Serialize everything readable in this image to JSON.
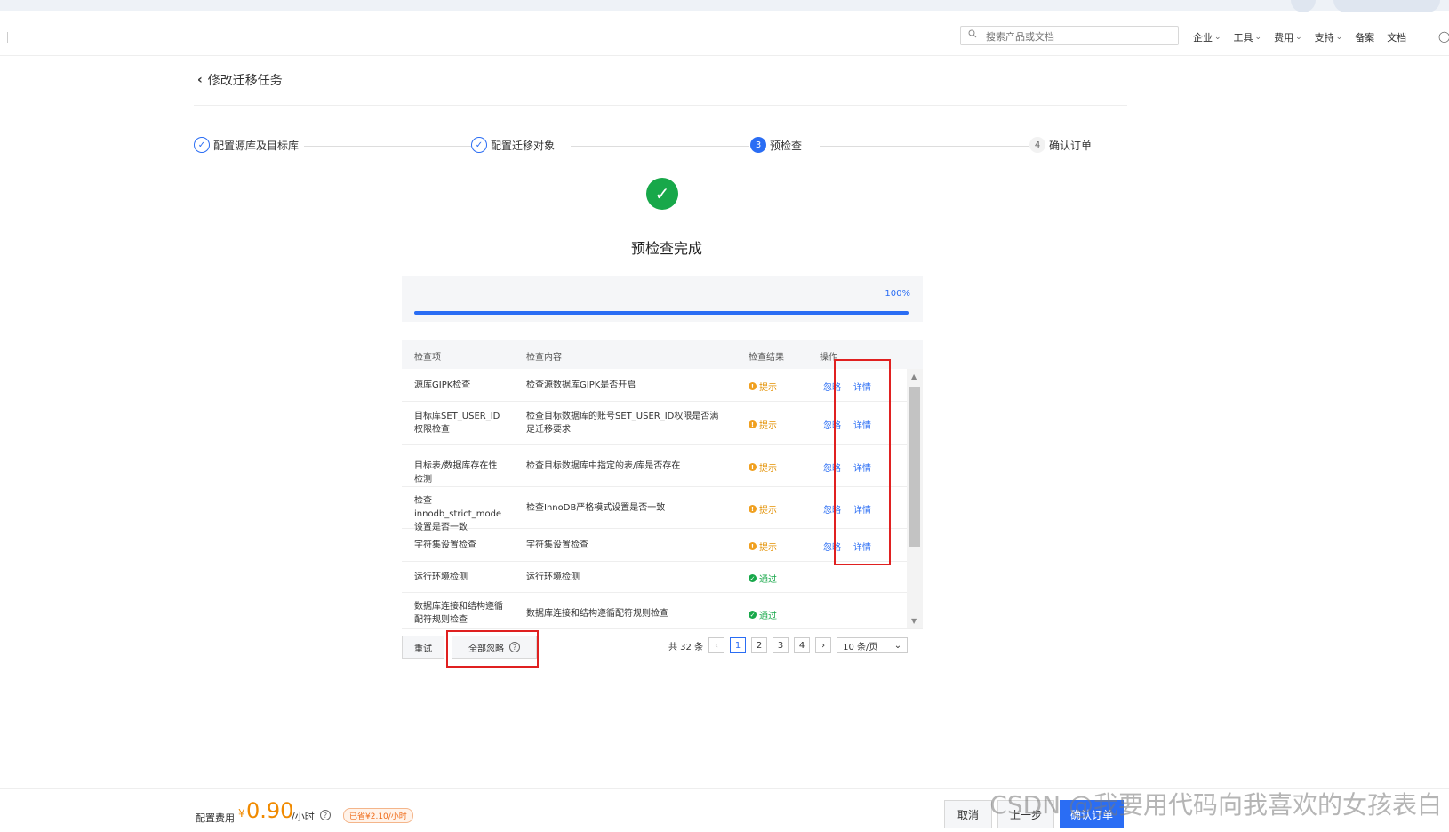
{
  "topbar": {
    "search_placeholder": "搜索产品或文档",
    "nav": [
      {
        "label": "企业",
        "dropdown": true
      },
      {
        "label": "工具",
        "dropdown": true
      },
      {
        "label": "费用",
        "dropdown": true
      },
      {
        "label": "支持",
        "dropdown": true
      },
      {
        "label": "备案",
        "dropdown": false
      },
      {
        "label": "文档",
        "dropdown": false
      }
    ]
  },
  "header": {
    "title": "修改迁移任务"
  },
  "steps": [
    {
      "num": "✓",
      "label": "配置源库及目标库",
      "state": "done"
    },
    {
      "num": "✓",
      "label": "配置迁移对象",
      "state": "done"
    },
    {
      "num": "3",
      "label": "预检查",
      "state": "active"
    },
    {
      "num": "4",
      "label": "确认订单",
      "state": "pending"
    }
  ],
  "status": {
    "title": "预检查完成"
  },
  "progress": {
    "percent_label": "100%",
    "value": 1.0
  },
  "table": {
    "columns": [
      "检查项",
      "检查内容",
      "检查结果",
      "操作"
    ],
    "rows": [
      {
        "item": "源库GIPK检查",
        "content": "检查源数据库GIPK是否开启",
        "result": "提示",
        "level": "warn",
        "actions": [
          "忽略",
          "详情"
        ]
      },
      {
        "item": "目标库SET_USER_ID权限检查",
        "content": "检查目标数据库的账号SET_USER_ID权限是否满足迁移要求",
        "result": "提示",
        "level": "warn",
        "actions": [
          "忽略",
          "详情"
        ]
      },
      {
        "item": "目标表/数据库存在性检测",
        "content": "检查目标数据库中指定的表/库是否存在",
        "result": "提示",
        "level": "warn",
        "actions": [
          "忽略",
          "详情"
        ]
      },
      {
        "item": "检查innodb_strict_mode设置是否一致",
        "content": "检查InnoDB严格模式设置是否一致",
        "result": "提示",
        "level": "warn",
        "actions": [
          "忽略",
          "详情"
        ]
      },
      {
        "item": "字符集设置检查",
        "content": "字符集设置检查",
        "result": "提示",
        "level": "warn",
        "actions": [
          "忽略",
          "详情"
        ]
      },
      {
        "item": "运行环境检测",
        "content": "运行环境检测",
        "result": "通过",
        "level": "pass",
        "actions": []
      },
      {
        "item": "数据库连接和结构遵循配符规则检查",
        "content": "数据库连接和结构遵循配符规则检查",
        "result": "通过",
        "level": "pass",
        "actions": []
      }
    ]
  },
  "actions": {
    "retry": "重试",
    "ignore_all": "全部忽略"
  },
  "pager": {
    "total": "共 32 条",
    "pages": [
      "1",
      "2",
      "3",
      "4"
    ],
    "current": "1",
    "size": "10 条/页"
  },
  "footer": {
    "fee_label": "配置费用",
    "currency": "¥",
    "fee_value": "0.90",
    "fee_unit": "/小时",
    "saved": "已省¥2.10/小时",
    "cancel": "取消",
    "prev": "上一步",
    "next": "确认订单"
  },
  "watermark": "CSDN @我要用代码向我喜欢的女孩表白",
  "colors": {
    "primary": "#2a6df4",
    "success": "#18a84a",
    "warning": "#f0a020",
    "fee": "#f08a00",
    "highlight": "#e02020"
  }
}
